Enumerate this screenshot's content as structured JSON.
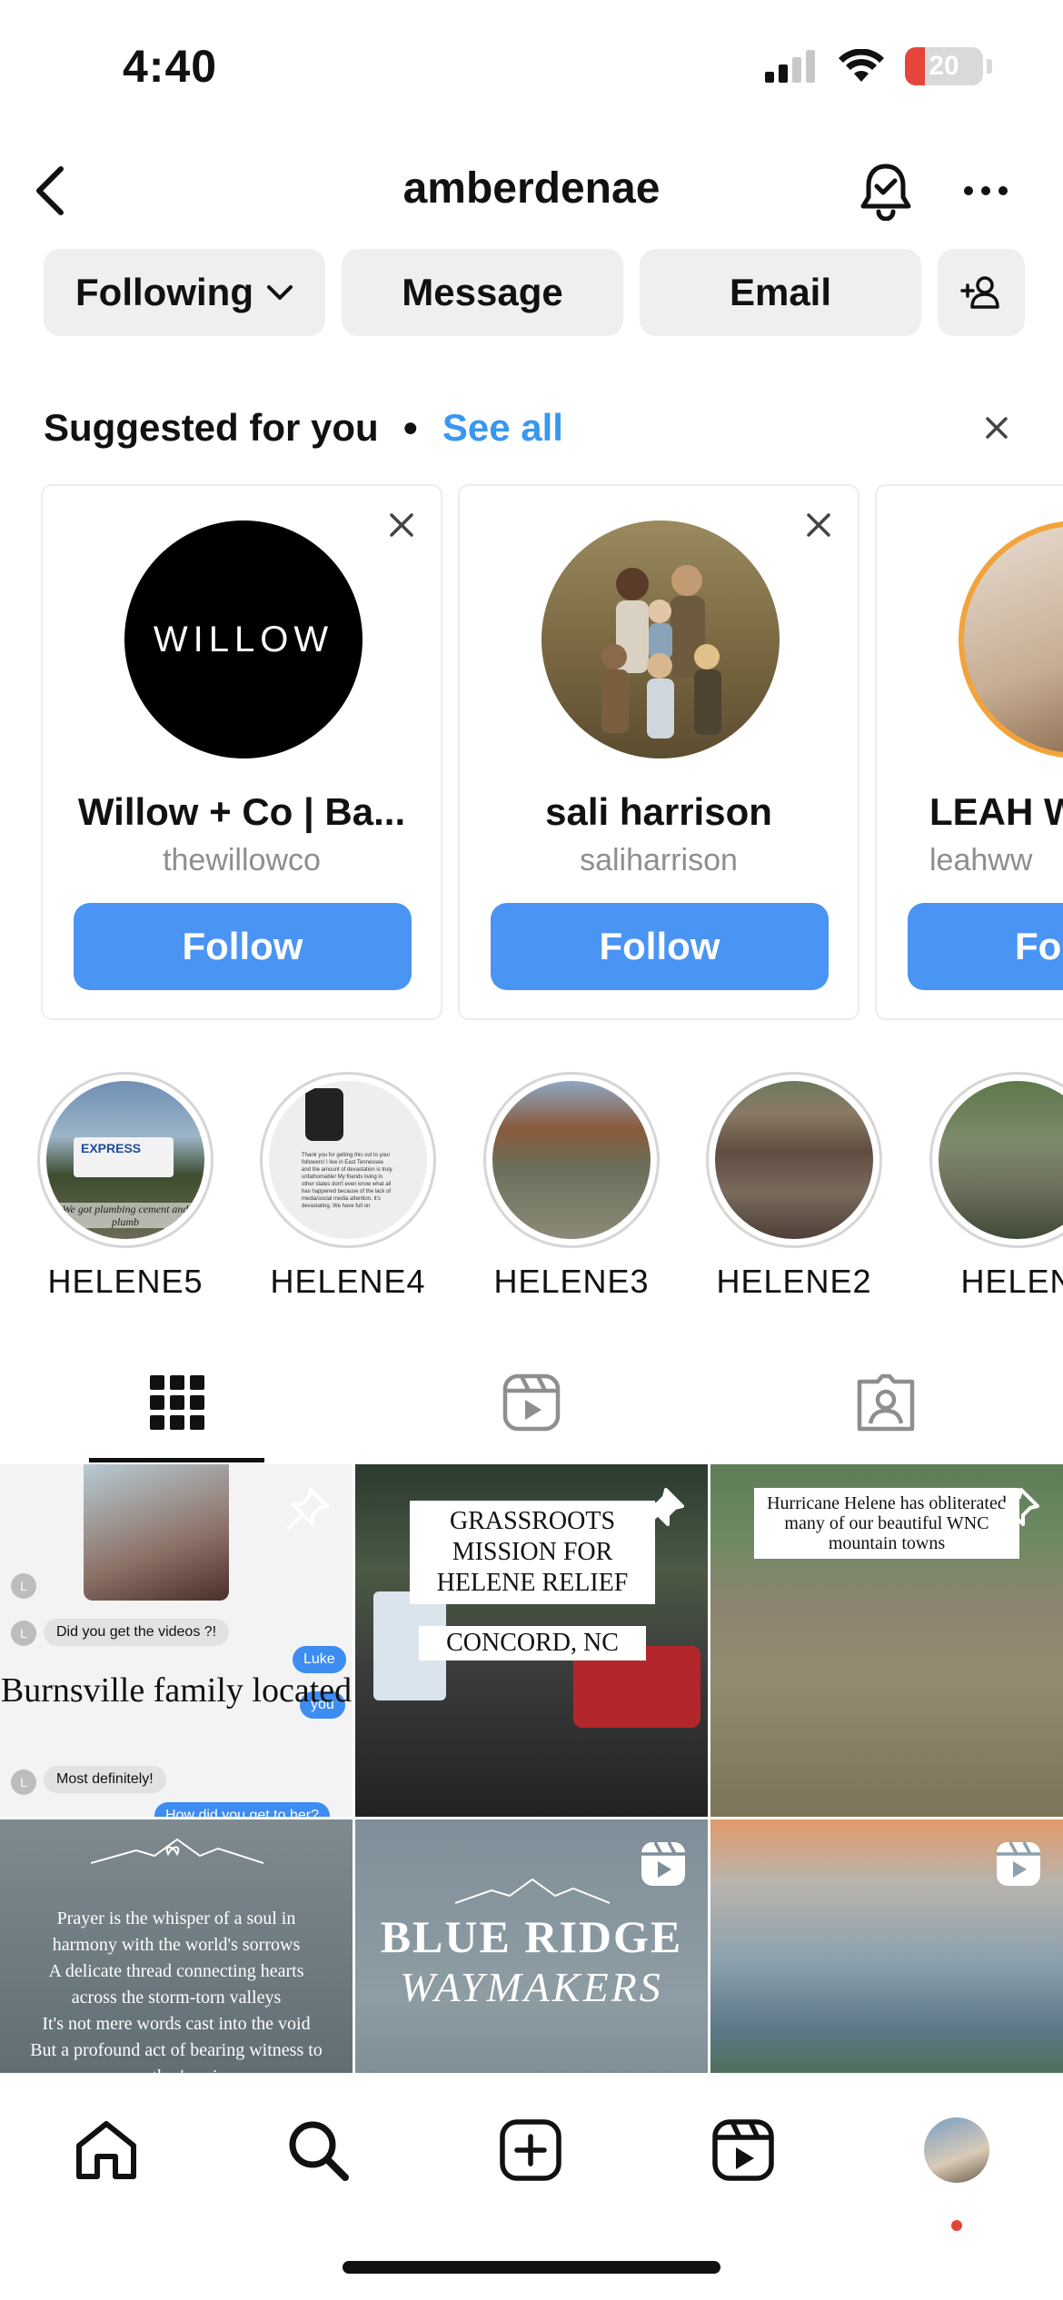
{
  "status_bar": {
    "time": "4:40",
    "battery": "20"
  },
  "header": {
    "username": "amberdenae"
  },
  "actions": {
    "following": "Following",
    "message": "Message",
    "email": "Email"
  },
  "suggested": {
    "title": "Suggested for you",
    "see_all": "See all",
    "cards": [
      {
        "name": "Willow + Co | Ba...",
        "handle": "thewillowco",
        "avatar_text": "WILLOW",
        "follow": "Follow"
      },
      {
        "name": "sali harrison",
        "handle": "saliharrison",
        "follow": "Follow"
      },
      {
        "name": "LEAH W",
        "handle": "leahww",
        "follow": "Fo"
      }
    ]
  },
  "highlights": [
    {
      "label": "HELENE5",
      "preview": {
        "van_text": "EXPRESS",
        "caption": "We got plumbing cement and plumb"
      }
    },
    {
      "label": "HELENE4",
      "preview": {
        "text": "Thank you for getting this out to your followers! I live in East Tennessee and the amount of devastation is truly unfathomable! My friends living in other states don't even know what all has happened because of the lack of media/social media attention. It's devastating. We have full on"
      }
    },
    {
      "label": "HELENE3"
    },
    {
      "label": "HELENE2"
    },
    {
      "label": "HELEN"
    }
  ],
  "grid": {
    "tile1": {
      "msg1": "Did you get the videos ?!",
      "caption": "Burnsville family located",
      "msg2": "Most definitely!",
      "blue1": "Luke",
      "blue2": "you",
      "blue3": "How did you get to her?",
      "avatar_letter": "L"
    },
    "tile2": {
      "label1": "GRASSROOTS MISSION FOR HELENE RELIEF",
      "label2": "CONCORD, NC"
    },
    "tile3": {
      "label": "Hurricane Helene has obliterated many of our beautiful WNC mountain towns"
    },
    "tile4": {
      "poem": [
        "Prayer is the whisper of a soul in",
        "harmony with the world's sorrows",
        "A delicate thread connecting hearts",
        "across the storm-torn valleys",
        "It's not mere words cast into the void",
        "But a profound act of bearing witness to",
        "another's pain"
      ]
    },
    "tile5": {
      "title1": "BLUE RIDGE",
      "title2": "WAYMAKERS"
    }
  },
  "colors": {
    "accent": "#3897f0",
    "follow_button": "#4a94f4",
    "notification_dot": "#e8413a"
  }
}
